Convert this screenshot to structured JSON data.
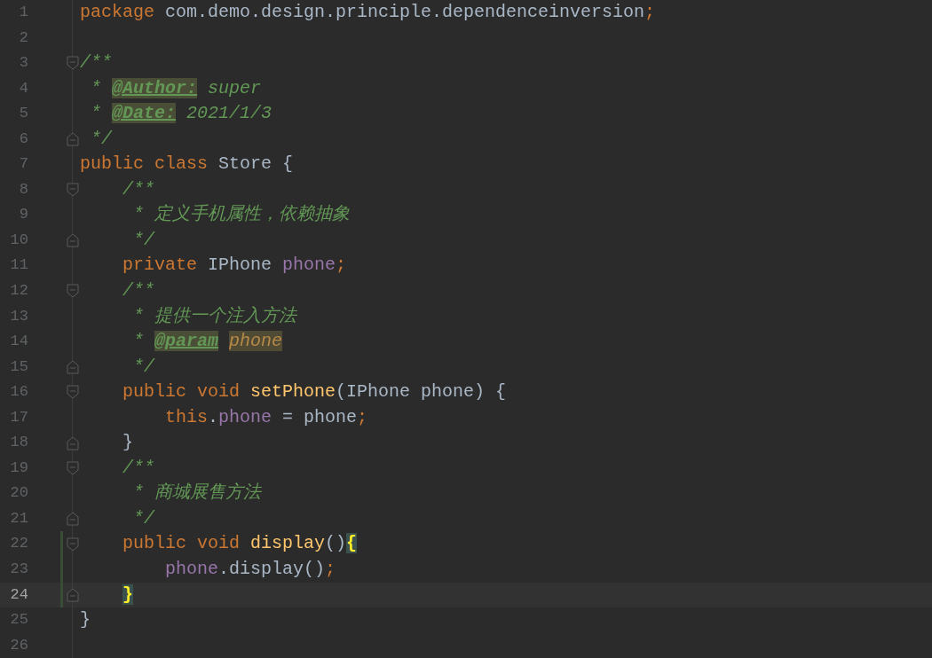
{
  "editor": {
    "lines": [
      {
        "number": "1",
        "fold_start": false,
        "fold_end": false,
        "changed": false,
        "current": false,
        "tokens": [
          {
            "kind": "kw",
            "text": "package "
          },
          {
            "kind": "plain",
            "text": "com.demo.design.principle.dependenceinversion"
          },
          {
            "kind": "punct",
            "text": ";"
          }
        ]
      },
      {
        "number": "2",
        "fold_start": false,
        "fold_end": false,
        "changed": false,
        "current": false
      },
      {
        "number": "3",
        "fold_start": true,
        "fold_end": false,
        "changed": false,
        "current": false,
        "tokens": [
          {
            "kind": "comment",
            "text": "/**"
          }
        ]
      },
      {
        "number": "4",
        "fold_start": false,
        "fold_end": false,
        "changed": false,
        "current": false,
        "tokens": [
          {
            "kind": "comment",
            "text": " * "
          },
          {
            "kind": "tag",
            "text": "@Author:"
          },
          {
            "kind": "comment",
            "text": " super"
          }
        ]
      },
      {
        "number": "5",
        "fold_start": false,
        "fold_end": false,
        "changed": false,
        "current": false,
        "tokens": [
          {
            "kind": "comment",
            "text": " * "
          },
          {
            "kind": "tag",
            "text": "@Date:"
          },
          {
            "kind": "comment",
            "text": " 2021/1/3"
          }
        ]
      },
      {
        "number": "6",
        "fold_start": false,
        "fold_end": true,
        "changed": false,
        "current": false,
        "tokens": [
          {
            "kind": "comment",
            "text": " */"
          }
        ]
      },
      {
        "number": "7",
        "fold_start": false,
        "fold_end": false,
        "changed": false,
        "current": false,
        "tokens": [
          {
            "kind": "kw",
            "text": "public class "
          },
          {
            "kind": "plain",
            "text": "Store {"
          }
        ]
      },
      {
        "number": "8",
        "fold_start": true,
        "fold_end": false,
        "changed": false,
        "current": false,
        "tokens": [
          {
            "kind": "comment",
            "text": "    /**"
          }
        ]
      },
      {
        "number": "9",
        "fold_start": false,
        "fold_end": false,
        "changed": false,
        "current": false,
        "tokens": [
          {
            "kind": "comment",
            "text": "     * 定义手机属性，依赖抽象"
          }
        ]
      },
      {
        "number": "10",
        "fold_start": false,
        "fold_end": true,
        "changed": false,
        "current": false,
        "tokens": [
          {
            "kind": "comment",
            "text": "     */"
          }
        ]
      },
      {
        "number": "11",
        "fold_start": false,
        "fold_end": false,
        "changed": false,
        "current": false,
        "tokens": [
          {
            "kind": "kw",
            "text": "    private "
          },
          {
            "kind": "plain",
            "text": "IPhone "
          },
          {
            "kind": "field",
            "text": "phone"
          },
          {
            "kind": "punct",
            "text": ";"
          }
        ]
      },
      {
        "number": "12",
        "fold_start": true,
        "fold_end": false,
        "changed": false,
        "current": false,
        "tokens": [
          {
            "kind": "comment",
            "text": "    /**"
          }
        ]
      },
      {
        "number": "13",
        "fold_start": false,
        "fold_end": false,
        "changed": false,
        "current": false,
        "tokens": [
          {
            "kind": "comment",
            "text": "     * 提供一个注入方法"
          }
        ]
      },
      {
        "number": "14",
        "fold_start": false,
        "fold_end": false,
        "changed": false,
        "current": false,
        "tokens": [
          {
            "kind": "comment",
            "text": "     * "
          },
          {
            "kind": "tag",
            "text": "@param"
          },
          {
            "kind": "param",
            "text": " phone"
          }
        ]
      },
      {
        "number": "15",
        "fold_start": false,
        "fold_end": true,
        "changed": false,
        "current": false,
        "tokens": [
          {
            "kind": "comment",
            "text": "     */"
          }
        ]
      },
      {
        "number": "16",
        "fold_start": true,
        "fold_end": false,
        "changed": false,
        "current": false,
        "tokens": [
          {
            "kind": "kw",
            "text": "    public void "
          },
          {
            "kind": "method",
            "text": "setPhone"
          },
          {
            "kind": "plain",
            "text": "(IPhone phone) {"
          }
        ]
      },
      {
        "number": "17",
        "fold_start": false,
        "fold_end": false,
        "changed": false,
        "current": false,
        "tokens": [
          {
            "kind": "kw",
            "text": "        this"
          },
          {
            "kind": "plain",
            "text": "."
          },
          {
            "kind": "field",
            "text": "phone"
          },
          {
            "kind": "plain",
            "text": " = phone"
          },
          {
            "kind": "punct",
            "text": ";"
          }
        ]
      },
      {
        "number": "18",
        "fold_start": false,
        "fold_end": true,
        "changed": false,
        "current": false,
        "tokens": [
          {
            "kind": "plain",
            "text": "    }"
          }
        ]
      },
      {
        "number": "19",
        "fold_start": true,
        "fold_end": false,
        "changed": false,
        "current": false,
        "tokens": [
          {
            "kind": "comment",
            "text": "    /**"
          }
        ]
      },
      {
        "number": "20",
        "fold_start": false,
        "fold_end": false,
        "changed": false,
        "current": false,
        "tokens": [
          {
            "kind": "comment",
            "text": "     * 商城展售方法"
          }
        ]
      },
      {
        "number": "21",
        "fold_start": false,
        "fold_end": true,
        "changed": false,
        "current": false,
        "tokens": [
          {
            "kind": "comment",
            "text": "     */"
          }
        ]
      },
      {
        "number": "22",
        "fold_start": true,
        "fold_end": false,
        "changed": true,
        "current": false,
        "tokens": [
          {
            "kind": "kw",
            "text": "    public void "
          },
          {
            "kind": "method",
            "text": "display"
          },
          {
            "kind": "plain",
            "text": "()"
          },
          {
            "kind": "brace",
            "text": "{"
          }
        ]
      },
      {
        "number": "23",
        "fold_start": false,
        "fold_end": false,
        "changed": true,
        "current": false,
        "tokens": [
          {
            "kind": "field",
            "text": "        phone"
          },
          {
            "kind": "plain",
            "text": ".display()"
          },
          {
            "kind": "punct",
            "text": ";"
          }
        ]
      },
      {
        "number": "24",
        "fold_start": false,
        "fold_end": true,
        "changed": true,
        "current": true,
        "tokens": [
          {
            "kind": "brace",
            "text": "    }"
          }
        ]
      },
      {
        "number": "25",
        "fold_start": false,
        "fold_end": false,
        "changed": false,
        "current": false,
        "tokens": [
          {
            "kind": "plain",
            "text": "}"
          }
        ]
      },
      {
        "number": "26",
        "fold_start": false,
        "fold_end": false,
        "changed": false,
        "current": false
      }
    ]
  }
}
